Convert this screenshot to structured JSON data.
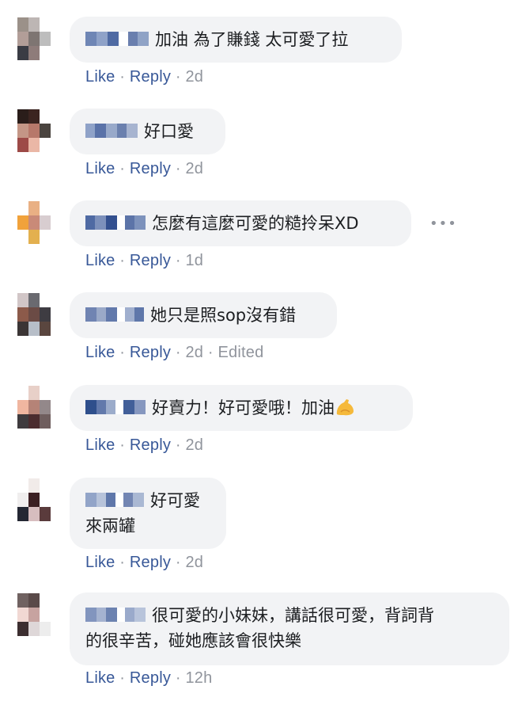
{
  "comments": [
    {
      "text": "加油 為了賺錢 太可愛了拉",
      "like": "Like",
      "reply": "Reply",
      "sep": "·",
      "time": "2d",
      "edited": ""
    },
    {
      "text": "好口愛",
      "like": "Like",
      "reply": "Reply",
      "sep": "·",
      "time": "2d",
      "edited": ""
    },
    {
      "text": "怎麼有這麼可愛的糙拎呆XD",
      "like": "Like",
      "reply": "Reply",
      "sep": "·",
      "time": "1d",
      "edited": "",
      "more": "•••"
    },
    {
      "text": "她只是照sop沒有錯",
      "like": "Like",
      "reply": "Reply",
      "sep": "·",
      "time": "2d",
      "edited": "Edited"
    },
    {
      "text": "好賣力！好可愛哦！加油",
      "like": "Like",
      "reply": "Reply",
      "sep": "·",
      "time": "2d",
      "edited": "",
      "emoji": "flexed-biceps-emoji"
    },
    {
      "text": "好可愛",
      "text2": "來兩罐",
      "like": "Like",
      "reply": "Reply",
      "sep": "·",
      "time": "2d",
      "edited": ""
    },
    {
      "text": "很可愛的小妹妹，講話很可愛，背詞背",
      "text2": "的很辛苦，碰她應該會很快樂",
      "like": "Like",
      "reply": "Reply",
      "sep": "·",
      "time": "12h",
      "edited": ""
    }
  ],
  "colors": {
    "bubble": "#f2f3f5",
    "link": "#385898",
    "meta": "#90949c",
    "text": "#1c1e21"
  }
}
